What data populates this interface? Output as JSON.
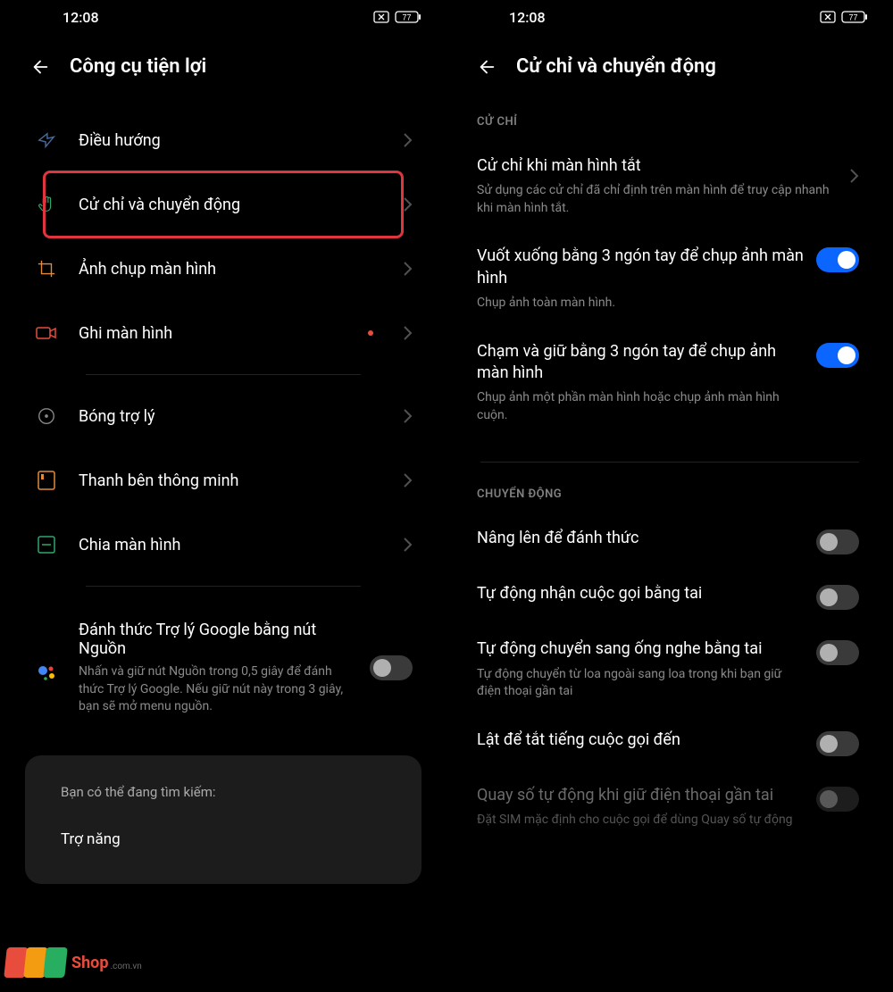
{
  "status": {
    "time": "12:08",
    "battery": "77"
  },
  "left": {
    "title": "Công cụ tiện lợi",
    "items": {
      "nav": {
        "label": "Điều hướng"
      },
      "gesture": {
        "label": "Cử chỉ và chuyển động"
      },
      "screenshot": {
        "label": "Ảnh chụp màn hình"
      },
      "record": {
        "label": "Ghi màn hình"
      },
      "assistball": {
        "label": "Bóng trợ lý"
      },
      "sidebar": {
        "label": "Thanh bên thông minh"
      },
      "split": {
        "label": "Chia màn hình"
      },
      "google": {
        "title": "Đánh thức Trợ lý Google bằng nút Nguồn",
        "sub": "Nhấn và giữ nút Nguồn trong 0,5 giây để đánh thức Trợ lý Google. Nếu giữ nút này trong 3 giây, bạn sẽ mở menu nguồn."
      }
    },
    "search": {
      "hint": "Bạn có thể đang tìm kiếm:",
      "item1": "Trợ năng"
    }
  },
  "right": {
    "title": "Cử chỉ và chuyển động",
    "sections": {
      "gesture": "CỬ CHỈ",
      "motion": "CHUYỂN ĐỘNG"
    },
    "items": {
      "screen_off": {
        "title": "Cử chỉ khi màn hình tắt",
        "sub": "Sử dụng các cử chỉ đã chỉ định trên màn hình để truy cập nhanh khi màn hình tắt."
      },
      "swipe3": {
        "title": "Vuốt xuống bằng 3 ngón tay để chụp ảnh màn hình",
        "sub": "Chụp ảnh toàn màn hình."
      },
      "hold3": {
        "title": "Chạm và giữ bằng 3 ngón tay để chụp ảnh màn hình",
        "sub": "Chụp ảnh một phần màn hình hoặc chụp ảnh màn hình cuộn."
      },
      "raise": {
        "title": "Nâng lên để đánh thức"
      },
      "ear_auto_answer": {
        "title": "Tự động nhận cuộc gọi bằng tai"
      },
      "ear_switch": {
        "title": "Tự động chuyển sang ống nghe bằng tai",
        "sub": "Tự động chuyển từ loa ngoài sang loa trong khi bạn giữ điện thoại gần tai"
      },
      "flip_mute": {
        "title": "Lật để tắt tiếng cuộc gọi đến"
      },
      "auto_dial": {
        "title": "Quay số tự động khi giữ điện thoại gần tai",
        "sub": "Đặt SIM mặc định cho cuộc gọi để dùng Quay số tự động"
      }
    }
  },
  "watermark": {
    "brand": "Shop",
    "sub": ".com.vn"
  }
}
